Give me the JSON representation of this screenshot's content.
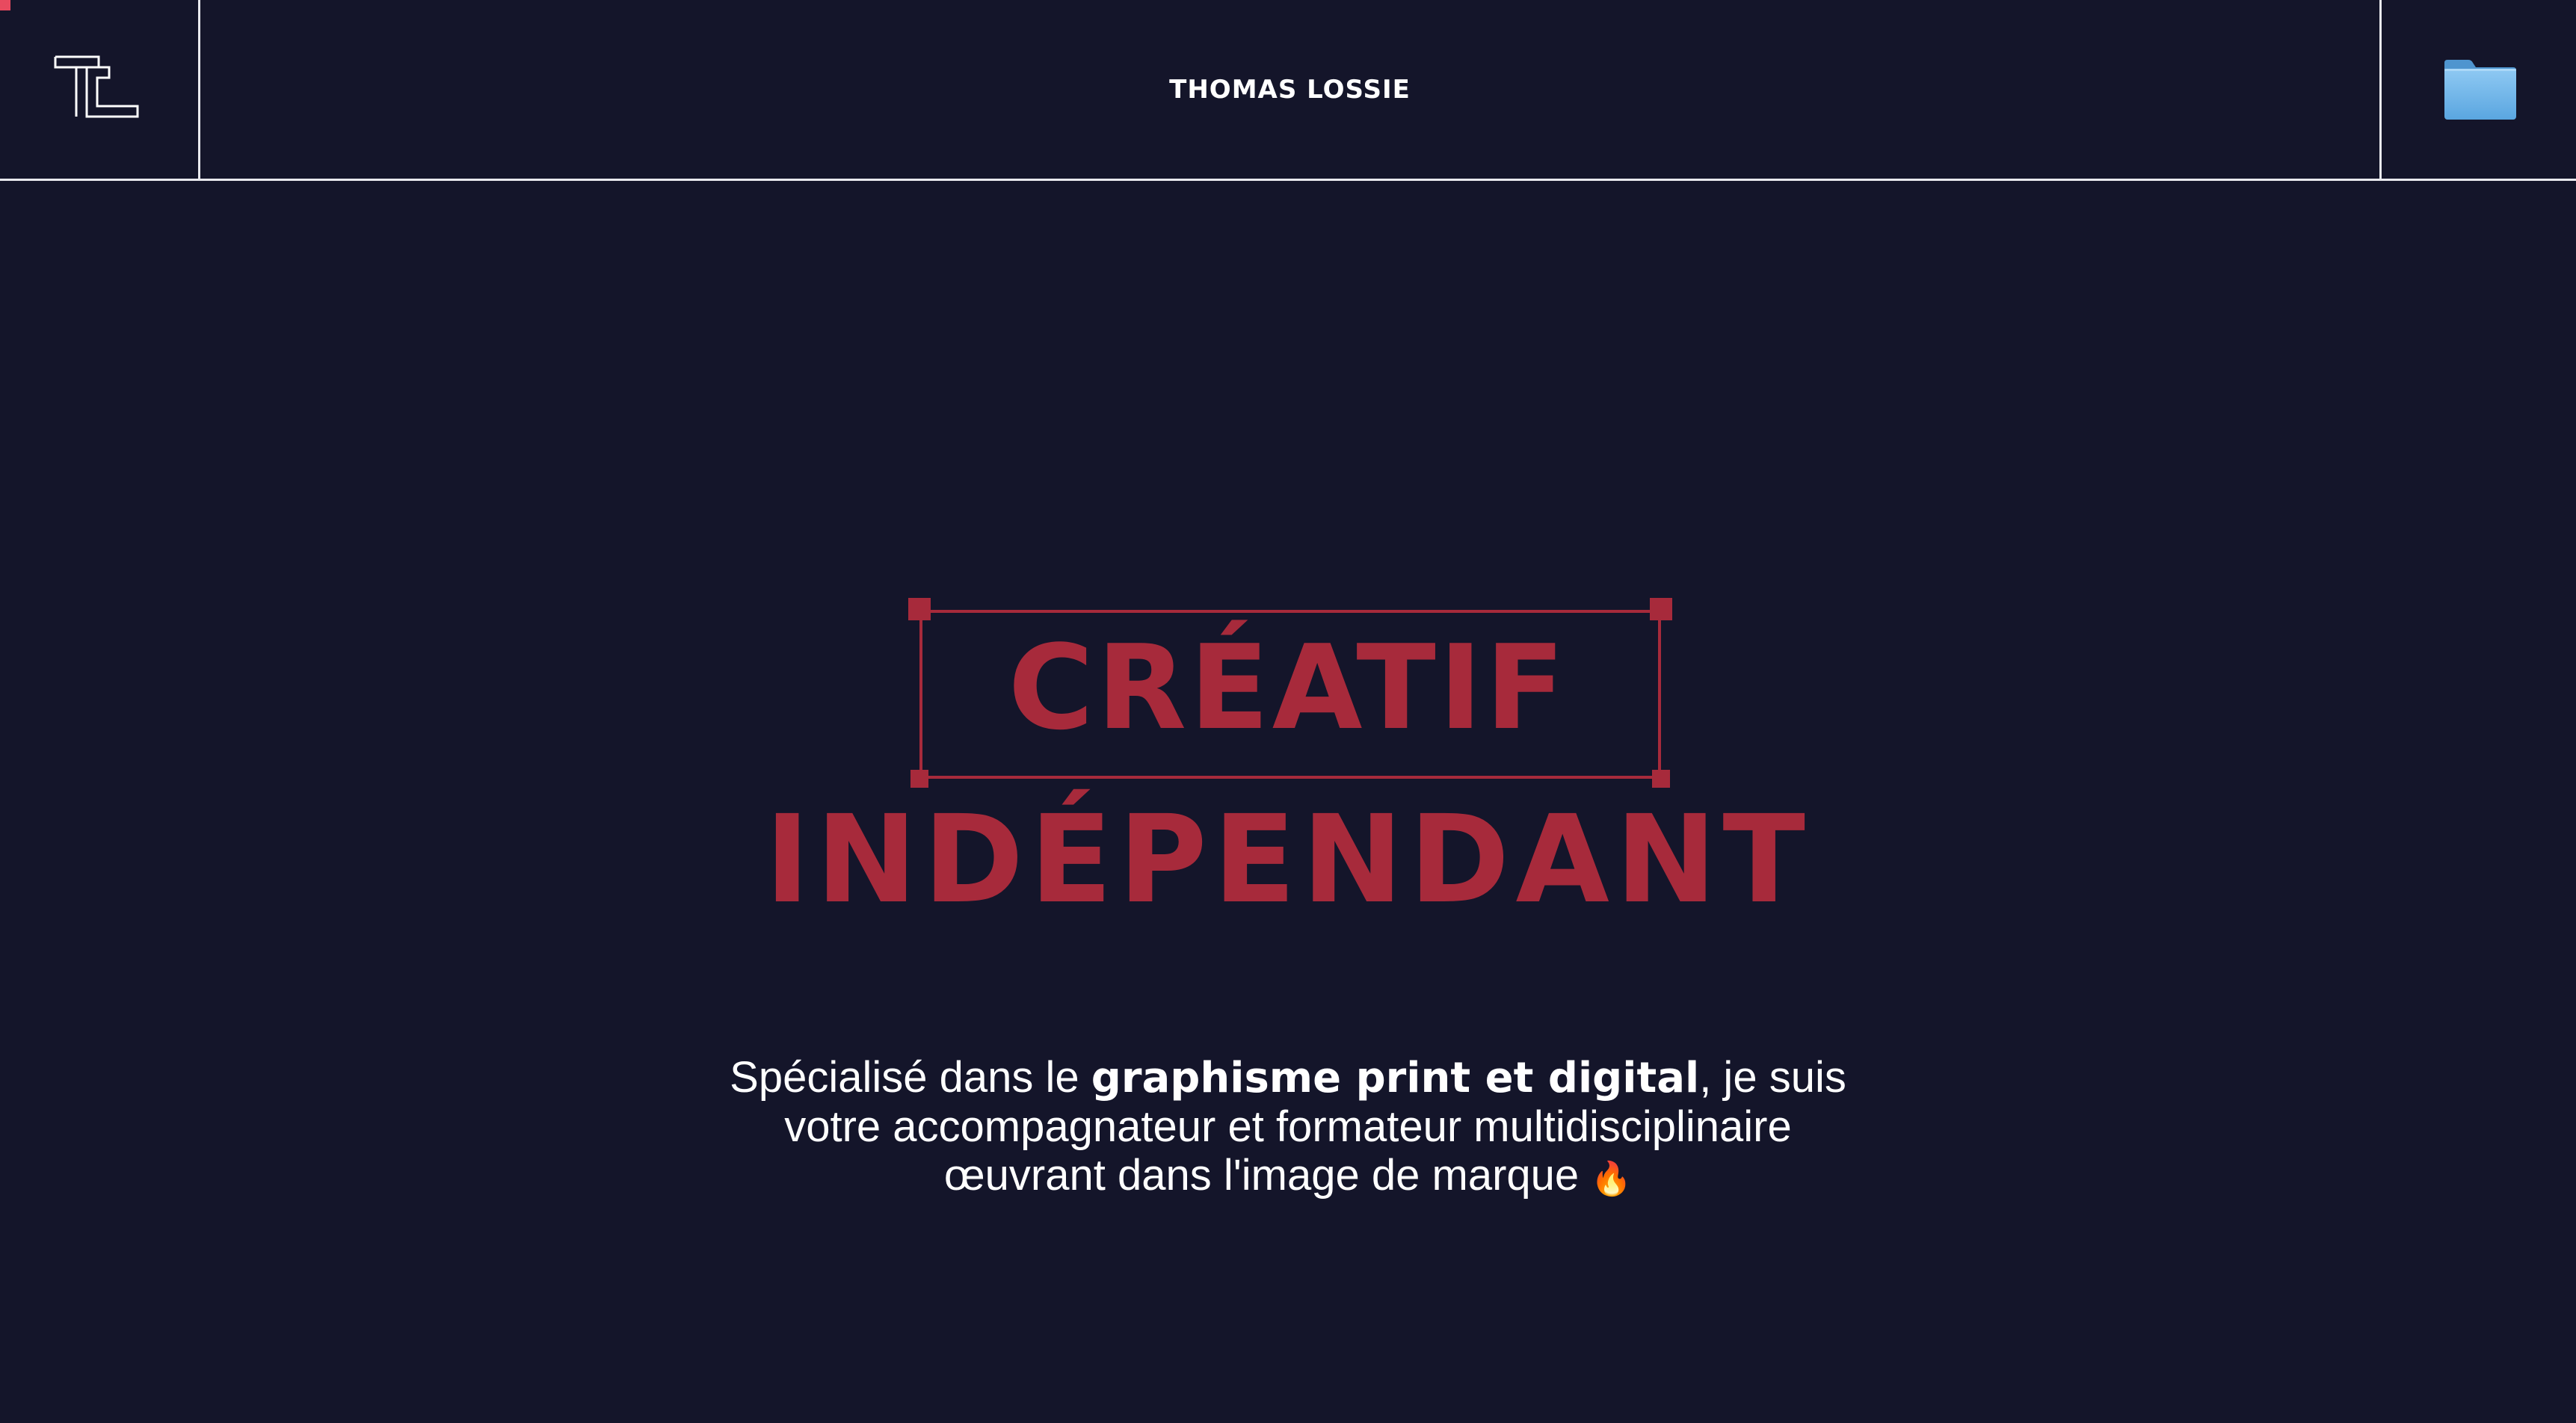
{
  "header": {
    "logo_icon": "tl-monogram-logo",
    "title": "THOMAS LOSSIE",
    "menu_icon": "folder-icon",
    "accent_color": "#e84a5f"
  },
  "hero": {
    "headline_line1": "CRÉATIF",
    "headline_line2": "INDÉPENDANT",
    "headline_color": "#a72a3b",
    "description": {
      "part1": "Spécialisé dans le ",
      "highlight": "graphisme print et digital",
      "part2": ", je suis",
      "line2": "votre accompagnateur et formateur multidisciplinaire",
      "line3": "œuvrant dans l'image de marque",
      "emoji": "🔥"
    }
  },
  "colors": {
    "background": "#14152a",
    "text": "#ffffff",
    "border": "#e9e9ee"
  }
}
